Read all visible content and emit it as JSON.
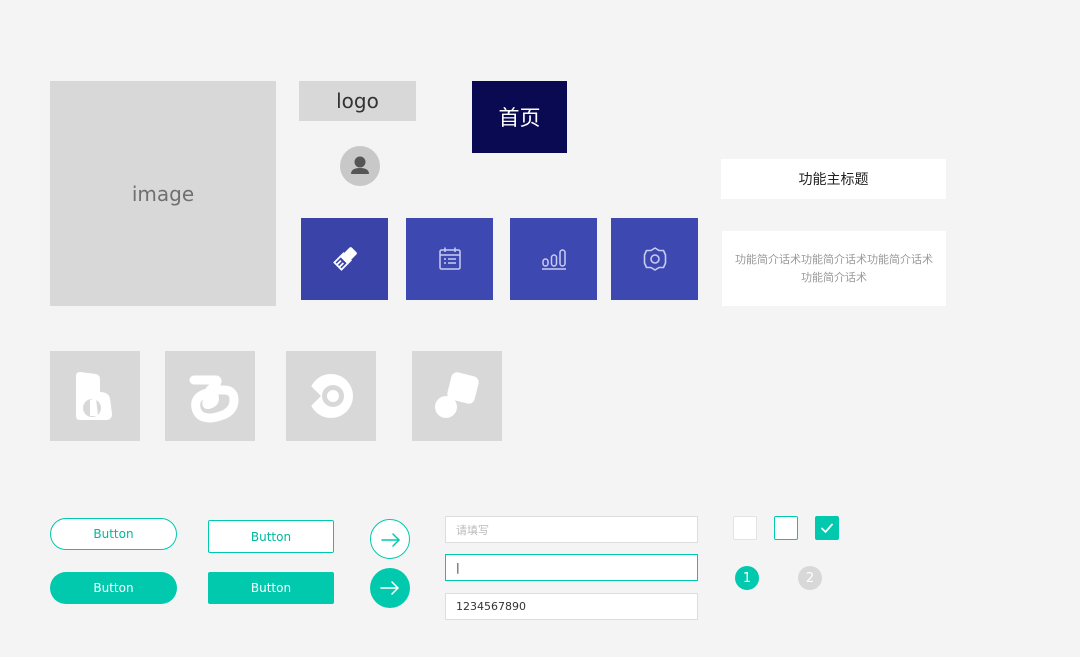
{
  "placeholders": {
    "image_label": "image",
    "logo_label": "logo"
  },
  "nav": {
    "home_label": "首页"
  },
  "feature_tiles": [
    {
      "icon": "paint-brush-icon"
    },
    {
      "icon": "calendar-list-icon"
    },
    {
      "icon": "bar-chart-icon"
    },
    {
      "icon": "settings-gear-icon"
    }
  ],
  "feature_card": {
    "title": "功能主标题",
    "description": "功能简介话术功能简介话术功能简介话术功能简介话术"
  },
  "app_icons": [
    "document-shape-icon",
    "swirl-shape-icon",
    "target-shape-icon",
    "rounded-square-circle-icon"
  ],
  "buttons": {
    "pill_outline": "Button",
    "pill_fill": "Button",
    "rect_outline": "Button",
    "rect_fill": "Button"
  },
  "inputs": {
    "placeholder": "请填写",
    "focused_value": "|",
    "filled_value": "1234567890"
  },
  "steps": [
    "1",
    "2"
  ],
  "colors": {
    "accent": "#00c9ad",
    "primary_dark": "#0a0a52",
    "tile_blue": "#3d49b0",
    "placeholder_gray": "#d8d8d8"
  }
}
